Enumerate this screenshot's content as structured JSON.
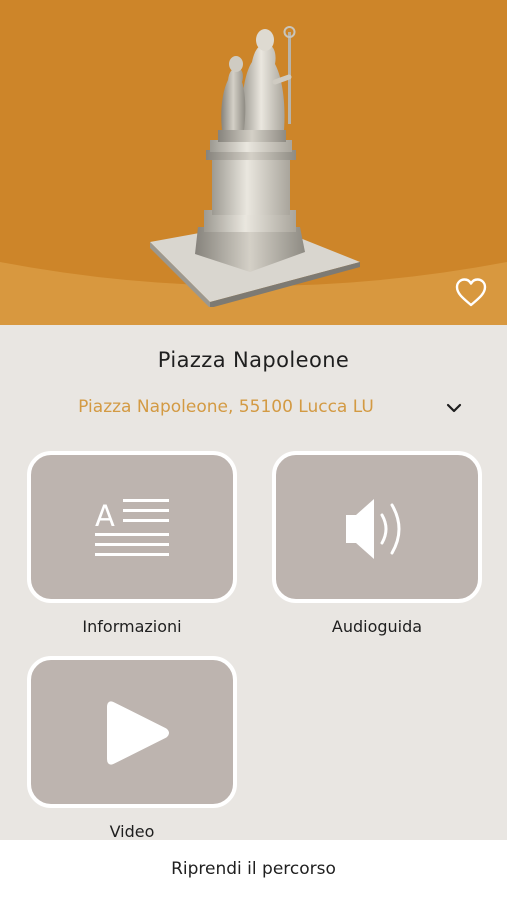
{
  "place": {
    "title": "Piazza Napoleone",
    "address": "Piazza Napoleone, 55100 Lucca LU"
  },
  "tiles": [
    {
      "label": "Informazioni",
      "icon": "text-document-icon"
    },
    {
      "label": "Audioguida",
      "icon": "speaker-icon"
    },
    {
      "label": "Video",
      "icon": "play-icon"
    }
  ],
  "footer": {
    "resume_label": "Riprendi il percorso"
  },
  "colors": {
    "hero_background": "#cd8529",
    "accent_text": "#d39a43",
    "tile_background": "#bdb4af",
    "page_background": "#e9e6e2"
  }
}
